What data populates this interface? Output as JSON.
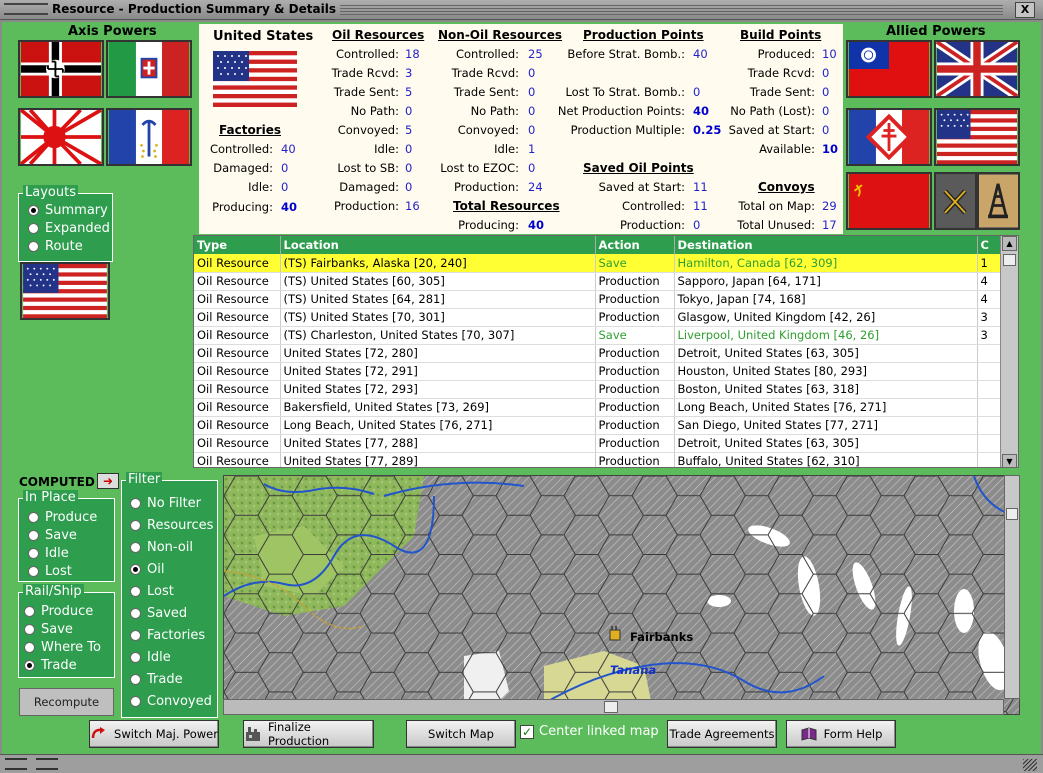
{
  "window": {
    "title": "Resource - Production Summary & Details",
    "close": "X"
  },
  "axis": {
    "title": "Axis Powers"
  },
  "allied": {
    "title": "Allied Powers"
  },
  "layouts": {
    "legend": "Layouts",
    "options": [
      "Summary",
      "Expanded",
      "Route"
    ],
    "selected": 0
  },
  "info": {
    "country": "United States",
    "factories": {
      "header": "Factories",
      "labels": [
        "Controlled:",
        "Damaged:",
        "Idle:",
        "Producing:"
      ],
      "values": [
        "40",
        "0",
        "0",
        "40"
      ]
    },
    "oil": {
      "header": "Oil Resources",
      "labels": [
        "Controlled:",
        "Trade Rcvd:",
        "Trade Sent:",
        "No Path:",
        "Convoyed:",
        "Idle:",
        "Lost to SB:",
        "Damaged:",
        "Production:"
      ],
      "values": [
        "18",
        "3",
        "5",
        "0",
        "5",
        "0",
        "0",
        "0",
        "16"
      ]
    },
    "nonoil": {
      "header": "Non-Oil Resources",
      "labels": [
        "Controlled:",
        "Trade Rcvd:",
        "Trade Sent:",
        "No Path:",
        "Convoyed:",
        "Idle:",
        "Lost to EZOC:",
        "Production:"
      ],
      "values": [
        "25",
        "0",
        "0",
        "0",
        "0",
        "1",
        "0",
        "24"
      ]
    },
    "total": {
      "header": "Total Resources",
      "label": "Producing:",
      "value": "40"
    },
    "production": {
      "header": "Production Points",
      "labels": [
        "Before Strat. Bomb.:",
        "Lost To Strat. Bomb.:",
        "Net Production Points:",
        "Production Multiple:"
      ],
      "values": [
        "40",
        "0",
        "40",
        "0.25"
      ]
    },
    "savedoil": {
      "header": "Saved Oil Points",
      "labels": [
        "Saved at Start:",
        "Controlled:",
        "Production:"
      ],
      "values": [
        "11",
        "11",
        "0"
      ]
    },
    "build": {
      "header": "Build Points",
      "labels": [
        "Produced:",
        "Trade Rcvd:",
        "Trade Sent:",
        "No Path (Lost):",
        "Saved at Start:",
        "Available:"
      ],
      "values": [
        "10",
        "0",
        "0",
        "0",
        "0",
        "10"
      ]
    },
    "convoys": {
      "header": "Convoys",
      "labels": [
        "Total on Map:",
        "Total Unused:"
      ],
      "values": [
        "29",
        "17"
      ]
    }
  },
  "table": {
    "headers": [
      "Type",
      "Location",
      "Action",
      "Destination",
      "C"
    ],
    "rows": [
      [
        "Oil Resource",
        "(TS) Fairbanks, Alaska [20, 240]",
        "Save",
        "Hamilton, Canada [62, 309]",
        "1"
      ],
      [
        "Oil Resource",
        "(TS) United States [60, 305]",
        "Production",
        "Sapporo, Japan [64, 171]",
        "4"
      ],
      [
        "Oil Resource",
        "(TS) United States [64, 281]",
        "Production",
        "Tokyo, Japan [74, 168]",
        "4"
      ],
      [
        "Oil Resource",
        "(TS) United States [70, 301]",
        "Production",
        "Glasgow, United Kingdom [42, 26]",
        "3"
      ],
      [
        "Oil Resource",
        "(TS) Charleston, United States [70, 307]",
        "Save",
        "Liverpool, United Kingdom [46, 26]",
        "3"
      ],
      [
        "Oil Resource",
        "United States [72, 280]",
        "Production",
        "Detroit, United States [63, 305]",
        ""
      ],
      [
        "Oil Resource",
        "United States [72, 291]",
        "Production",
        "Houston, United States [80, 293]",
        ""
      ],
      [
        "Oil Resource",
        "United States [72, 293]",
        "Production",
        "Boston, United States [63, 318]",
        ""
      ],
      [
        "Oil Resource",
        "Bakersfield, United States [73, 269]",
        "Production",
        "Long Beach, United States [76, 271]",
        ""
      ],
      [
        "Oil Resource",
        "Long Beach, United States [76, 271]",
        "Production",
        "San Diego, United States [77, 271]",
        ""
      ],
      [
        "Oil Resource",
        "United States [77, 288]",
        "Production",
        "Detroit, United States [63, 305]",
        ""
      ],
      [
        "Oil Resource",
        "United States [77, 289]",
        "Production",
        "Buffalo, United States [62, 310]",
        ""
      ]
    ],
    "highlight_row": 0
  },
  "computed": {
    "label": "COMPUTED"
  },
  "inplace": {
    "legend": "In Place",
    "options": [
      "Produce",
      "Save",
      "Idle",
      "Lost"
    ]
  },
  "railship": {
    "legend": "Rail/Ship",
    "options": [
      "Produce",
      "Save",
      "Where To",
      "Trade"
    ],
    "selected": 3
  },
  "filter": {
    "legend": "Filter",
    "options": [
      "No Filter",
      "Resources",
      "Non-oil",
      "Oil",
      "Lost",
      "Saved",
      "Factories",
      "Idle",
      "Trade",
      "Convoyed"
    ],
    "selected": 3
  },
  "recompute": {
    "label": "Recompute"
  },
  "map": {
    "city": "Fairbanks",
    "river": "Tanana"
  },
  "buttons": {
    "switch_major": "Switch Maj. Power",
    "finalize": "Finalize Production",
    "switch_map": "Switch Map",
    "center_linked": "Center linked map",
    "trade": "Trade Agreements",
    "form_help": "Form Help"
  },
  "colors": {
    "panel_green": "#5cbc5c",
    "header_green": "#2e9e4e",
    "highlight": "#ffff33",
    "value_blue": "#2222cc"
  }
}
